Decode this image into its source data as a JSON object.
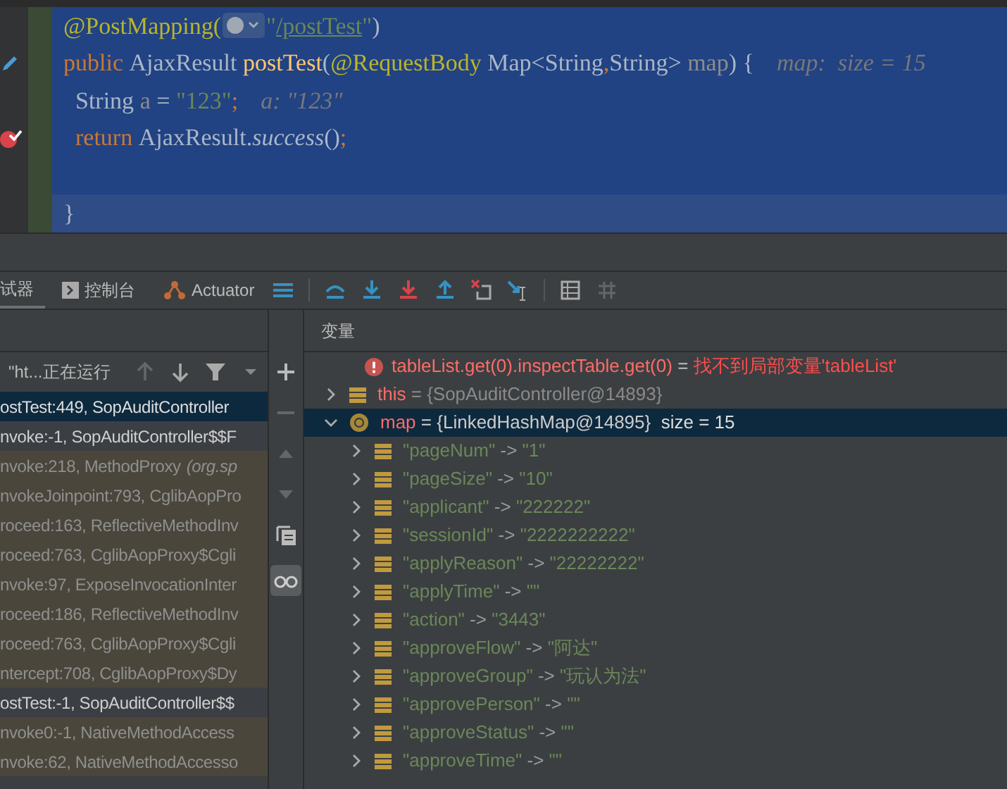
{
  "editor": {
    "lines": [
      {
        "kind": "plain",
        "tokens": [
          {
            "kind": "annotation",
            "text": "@PostMapping("
          },
          {
            "kind": "globe"
          },
          {
            "kind": "string",
            "text": "\""
          },
          {
            "kind": "link",
            "text": "/postTest"
          },
          {
            "kind": "string",
            "text": "\""
          },
          {
            "kind": "plain",
            "text": ")"
          }
        ]
      },
      {
        "kind": "edited",
        "tokens": [
          {
            "kind": "keyword",
            "text": "public "
          },
          {
            "kind": "plain",
            "text": "AjaxResult "
          },
          {
            "kind": "method",
            "text": "postTest"
          },
          {
            "kind": "plain",
            "text": "("
          },
          {
            "kind": "annotation",
            "text": "@RequestBody"
          },
          {
            "kind": "plain",
            "text": " Map<String"
          },
          {
            "kind": "keyword",
            "text": ","
          },
          {
            "kind": "plain",
            "text": "String> "
          },
          {
            "kind": "param",
            "text": "map"
          },
          {
            "kind": "plain",
            "text": ") {"
          },
          {
            "kind": "hint",
            "text": "map:  size = 15"
          }
        ]
      },
      {
        "kind": "plain",
        "tokens": [
          {
            "kind": "plain",
            "text": "  String "
          },
          {
            "kind": "param",
            "text": "a"
          },
          {
            "kind": "plain",
            "text": " = "
          },
          {
            "kind": "string",
            "text": "\"123\""
          },
          {
            "kind": "keyword",
            "text": ";"
          },
          {
            "kind": "hint",
            "text": "a: \"123\""
          }
        ]
      },
      {
        "kind": "breakpoint",
        "tokens": [
          {
            "kind": "keyword",
            "text": "  return "
          },
          {
            "kind": "plain",
            "text": "AjaxResult."
          },
          {
            "kind": "italic",
            "text": "success"
          },
          {
            "kind": "plain",
            "text": "()"
          },
          {
            "kind": "keyword",
            "text": ";"
          }
        ]
      },
      {
        "kind": "plain",
        "blank_before": true,
        "tokens": [
          {
            "kind": "plain",
            "text": "}"
          }
        ]
      }
    ]
  },
  "toolbar": {
    "tabs": [
      {
        "label": "试器",
        "selected": true
      },
      {
        "label": "控制台",
        "selected": false
      },
      {
        "label": "Actuator",
        "selected": false
      }
    ]
  },
  "frames_panel": {
    "thread": "\"ht...正在运行",
    "frames": [
      {
        "text": "ostTest:449, SopAuditController",
        "kind": "user",
        "selected": true
      },
      {
        "text": "nvoke:-1, SopAuditController$$F",
        "kind": "user",
        "selected": false
      },
      {
        "text": "nvoke:218, MethodProxy",
        "package": "(org.sp",
        "kind": "library",
        "selected": false
      },
      {
        "text": "nvokeJoinpoint:793, CglibAopPro",
        "kind": "library",
        "selected": false
      },
      {
        "text": "roceed:163, ReflectiveMethodInv",
        "kind": "library",
        "selected": false
      },
      {
        "text": "roceed:763, CglibAopProxy$Cgli",
        "kind": "library",
        "selected": false
      },
      {
        "text": "nvoke:97, ExposeInvocationInter",
        "kind": "library",
        "selected": false
      },
      {
        "text": "roceed:186, ReflectiveMethodInv",
        "kind": "library",
        "selected": false
      },
      {
        "text": "roceed:763, CglibAopProxy$Cgli",
        "kind": "library",
        "selected": false
      },
      {
        "text": "ntercept:708, CglibAopProxy$Dy",
        "kind": "library",
        "selected": false
      },
      {
        "text": "ostTest:-1, SopAuditController$$",
        "kind": "user",
        "selected": false
      },
      {
        "text": "nvoke0:-1, NativeMethodAccess",
        "kind": "library",
        "selected": false
      },
      {
        "text": "nvoke:62, NativeMethodAccesso",
        "kind": "library",
        "selected": false
      }
    ]
  },
  "variables_panel": {
    "title": "变量",
    "error": {
      "expression": "tableList.get(0).inspectTable.get(0)",
      "equals": " = ",
      "message": "找不到局部变量'tableList'"
    },
    "variables": [
      {
        "name": "this",
        "value": "= {SopAuditController@14893}",
        "kind": "field",
        "expanded": false,
        "selected": false
      },
      {
        "name": "map",
        "value": "= {LinkedHashMap@14895}",
        "size": "size = 15",
        "kind": "param",
        "expanded": true,
        "selected": true,
        "children": [
          {
            "key": "\"pageNum\"",
            "arrow": "->",
            "value": "\"1\"",
            "expanded": false
          },
          {
            "key": "\"pageSize\"",
            "arrow": "->",
            "value": "\"10\"",
            "expanded": false
          },
          {
            "key": "\"applicant\"",
            "arrow": "->",
            "value": "\"222222\"",
            "expanded": false
          },
          {
            "key": "\"sessionId\"",
            "arrow": "->",
            "value": "\"2222222222\"",
            "expanded": false
          },
          {
            "key": "\"applyReason\"",
            "arrow": "->",
            "value": "\"22222222\"",
            "expanded": false
          },
          {
            "key": "\"applyTime\"",
            "arrow": "->",
            "value": "\"\"",
            "expanded": false
          },
          {
            "key": "\"action\"",
            "arrow": "->",
            "value": "\"3443\"",
            "expanded": false
          },
          {
            "key": "\"approveFlow\"",
            "arrow": "->",
            "value": "\"阿达\"",
            "expanded": false
          },
          {
            "key": "\"approveGroup\"",
            "arrow": "->",
            "value": "\"玩认为法\"",
            "expanded": false
          },
          {
            "key": "\"approvePerson\"",
            "arrow": "->",
            "value": "\"\"",
            "expanded": false
          },
          {
            "key": "\"approveStatus\"",
            "arrow": "->",
            "value": "\"\"",
            "expanded": false
          },
          {
            "key": "\"approveTime\"",
            "arrow": "->",
            "value": "\"\"",
            "expanded": false
          }
        ]
      }
    ]
  }
}
